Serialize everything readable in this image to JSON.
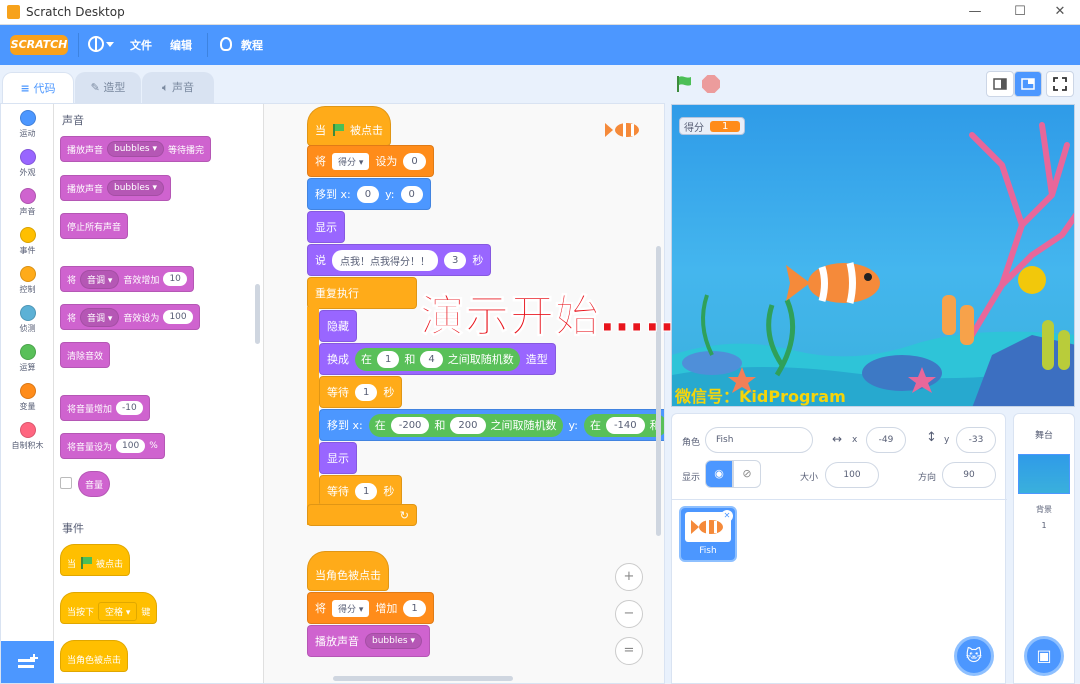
{
  "window": {
    "title": "Scratch Desktop",
    "controls": [
      "—",
      "☐",
      "✕"
    ]
  },
  "menubar": {
    "logo": "SCRATCH",
    "file": "文件",
    "edit": "编辑",
    "tutorials": "教程"
  },
  "tabs": {
    "code": "代码",
    "costumes": "造型",
    "sounds": "声音"
  },
  "categories": [
    {
      "label": "运动",
      "color": "#4c97ff"
    },
    {
      "label": "外观",
      "color": "#9966ff"
    },
    {
      "label": "声音",
      "color": "#cf63cf"
    },
    {
      "label": "事件",
      "color": "#ffbf00"
    },
    {
      "label": "控制",
      "color": "#ffab19"
    },
    {
      "label": "侦测",
      "color": "#5cb1d6"
    },
    {
      "label": "运算",
      "color": "#59c059"
    },
    {
      "label": "变量",
      "color": "#ff8c1a"
    },
    {
      "label": "自制积木",
      "color": "#ff6680"
    }
  ],
  "palette": {
    "sound_header": "声音",
    "play_until_done": {
      "a": "播放声音",
      "sound": "bubbles",
      "b": "等待播完"
    },
    "start_sound": {
      "a": "播放声音",
      "sound": "bubbles"
    },
    "stop_all": "停止所有声音",
    "change_effect": {
      "a": "将",
      "effect": "音调",
      "b": "音效增加",
      "val": "10"
    },
    "set_effect": {
      "a": "将",
      "effect": "音调",
      "b": "音效设为",
      "val": "100"
    },
    "clear_effects": "清除音效",
    "change_volume": {
      "a": "将音量增加",
      "val": "-10"
    },
    "set_volume": {
      "a": "将音量设为",
      "val": "100",
      "b": "%"
    },
    "volume": "音量",
    "events_header": "事件",
    "when_flag": {
      "a": "当",
      "b": "被点击"
    },
    "when_key": {
      "a": "当按下",
      "key": "空格",
      "b": "键"
    },
    "when_sprite_clicked": "当角色被点击"
  },
  "script1": {
    "when_flag": {
      "a": "当",
      "b": "被点击"
    },
    "set_var": {
      "a": "将",
      "var": "得分",
      "b": "设为",
      "val": "0"
    },
    "goto": {
      "a": "移到 x:",
      "x": "0",
      "b": "y:",
      "y": "0"
    },
    "show": "显示",
    "say": {
      "a": "说",
      "msg": "点我！点我得分！！",
      "secs": "3",
      "b": "秒"
    },
    "forever": "重复执行",
    "hide": "隐藏",
    "switch_costume": {
      "a": "换成",
      "in": "在",
      "from": "1",
      "and": "和",
      "to": "4",
      "rand": "之间取随机数",
      "b": "造型"
    },
    "wait1": {
      "a": "等待",
      "val": "1",
      "b": "秒"
    },
    "goto_rand": {
      "a": "移到 x:",
      "in": "在",
      "x1": "-200",
      "and": "和",
      "x2": "200",
      "rand": "之间取随机数",
      "y": "y:",
      "in2": "在",
      "y1": "-140",
      "and2": "和"
    },
    "show2": "显示",
    "wait2": {
      "a": "等待",
      "val": "1",
      "b": "秒"
    }
  },
  "script2": {
    "when_clicked": "当角色被点击",
    "change_var": {
      "a": "将",
      "var": "得分",
      "b": "增加",
      "val": "1"
    },
    "start_sound": {
      "a": "播放声音",
      "sound": "bubbles"
    }
  },
  "zoom": {
    "in": "+",
    "out": "−",
    "reset": "="
  },
  "overlay_text": "演示开始……",
  "stage": {
    "var_label": "得分",
    "var_value": "1",
    "watermark": "微信号：KidProgram"
  },
  "sprite_info": {
    "sprite_label": "角色",
    "sprite_name": "Fish",
    "x_label": "x",
    "x": "-49",
    "y_label": "y",
    "y": "-33",
    "show_label": "显示",
    "size_label": "大小",
    "size": "100",
    "direction_label": "方向",
    "direction": "90"
  },
  "sprites": [
    {
      "name": "Fish"
    }
  ],
  "stage_pane": {
    "title": "舞台",
    "backdrops_label": "背景",
    "backdrops_count": "1"
  },
  "colors": {
    "accent": "#4c97ff",
    "events": "#ffab19",
    "variables": "#ff8c1a",
    "motion": "#4c97ff",
    "looks": "#9966ff",
    "sound": "#cf63cf",
    "operators": "#59c059"
  }
}
